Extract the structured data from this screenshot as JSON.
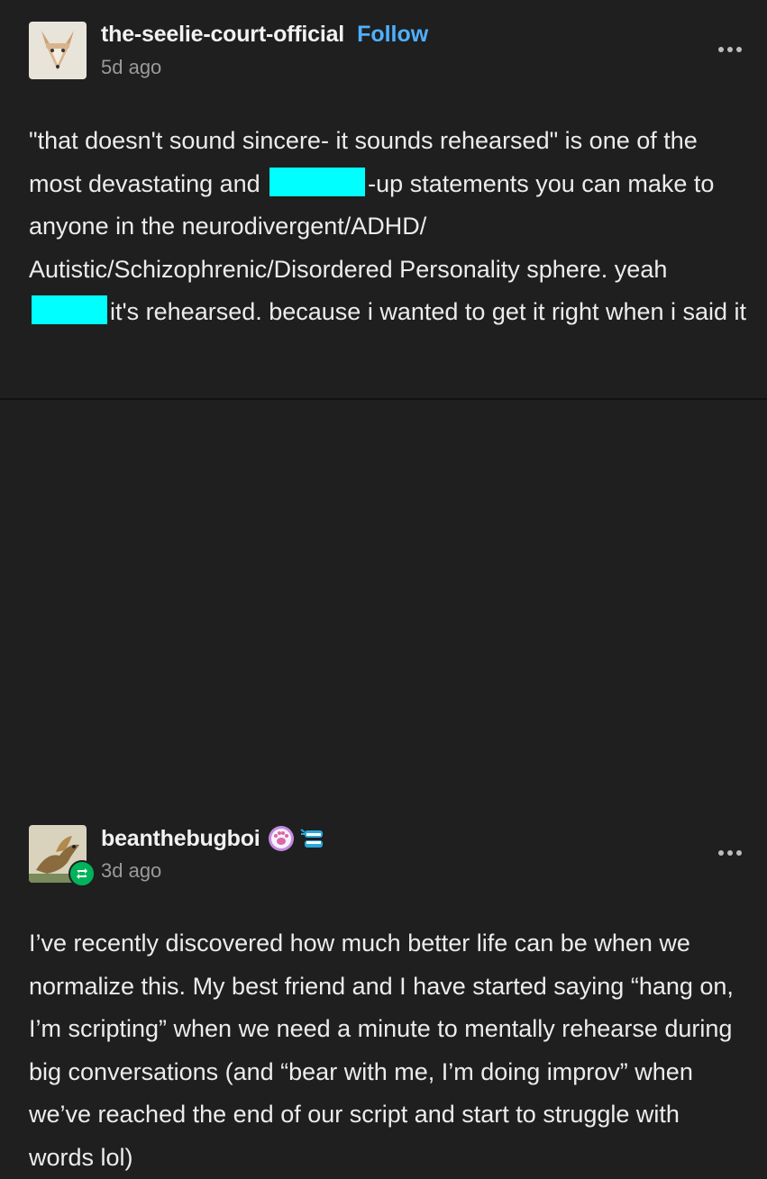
{
  "post1": {
    "username": "the-seelie-court-official",
    "follow_label": "Follow",
    "time_ago": "5d ago",
    "text_a": "\"that doesn't sound sincere- it sounds rehearsed\" is one of the most devastating and ",
    "text_b": "-up statements you can make to anyone in the neurodivergent/ADHD/ Autistic/Schizophrenic/Disordered Personality sphere. yeah ",
    "text_c": "it's rehearsed. because i wanted to get it right when i said it"
  },
  "post2": {
    "username": "beanthebugboi",
    "time_ago": "3d ago",
    "text": "I’ve recently discovered how much better life can be when we normalize this. My best friend and I have started saying “hang on, I’m scripting” when we need a minute to mentally rehearse during big conversations (and “bear with me, I’m doing improv” when we’ve reached the end of our script and start to struggle with words lol)"
  },
  "icons": {
    "more": "more-horizontal-icon",
    "reblog": "reblog-icon",
    "badge1": "paw-badge-icon",
    "badge2": "dentures-badge-icon"
  },
  "colors": {
    "background": "#1f1f1f",
    "follow": "#4fb0ff",
    "redaction": "#00ffff",
    "reblog": "#00b35b"
  }
}
